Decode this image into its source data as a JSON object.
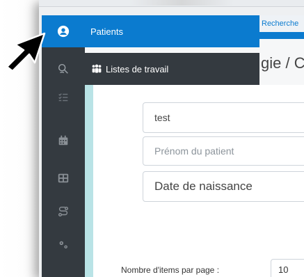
{
  "menu": {
    "patients_label": "Patients",
    "worklists_label": "Listes de travail"
  },
  "header": {
    "search_tab": "Recherche",
    "title_fragment": "gie / C"
  },
  "form": {
    "last_name_value": "test",
    "first_name_placeholder": "Prénom du patient",
    "birthdate_placeholder": "Date de naissance"
  },
  "pagination": {
    "items_per_page_label": "Nombre d'items par page :",
    "items_per_page_value": "10"
  },
  "colors": {
    "accent": "#0b7bcf",
    "sidebar": "#343a40",
    "teal": "#b9e3e6"
  }
}
